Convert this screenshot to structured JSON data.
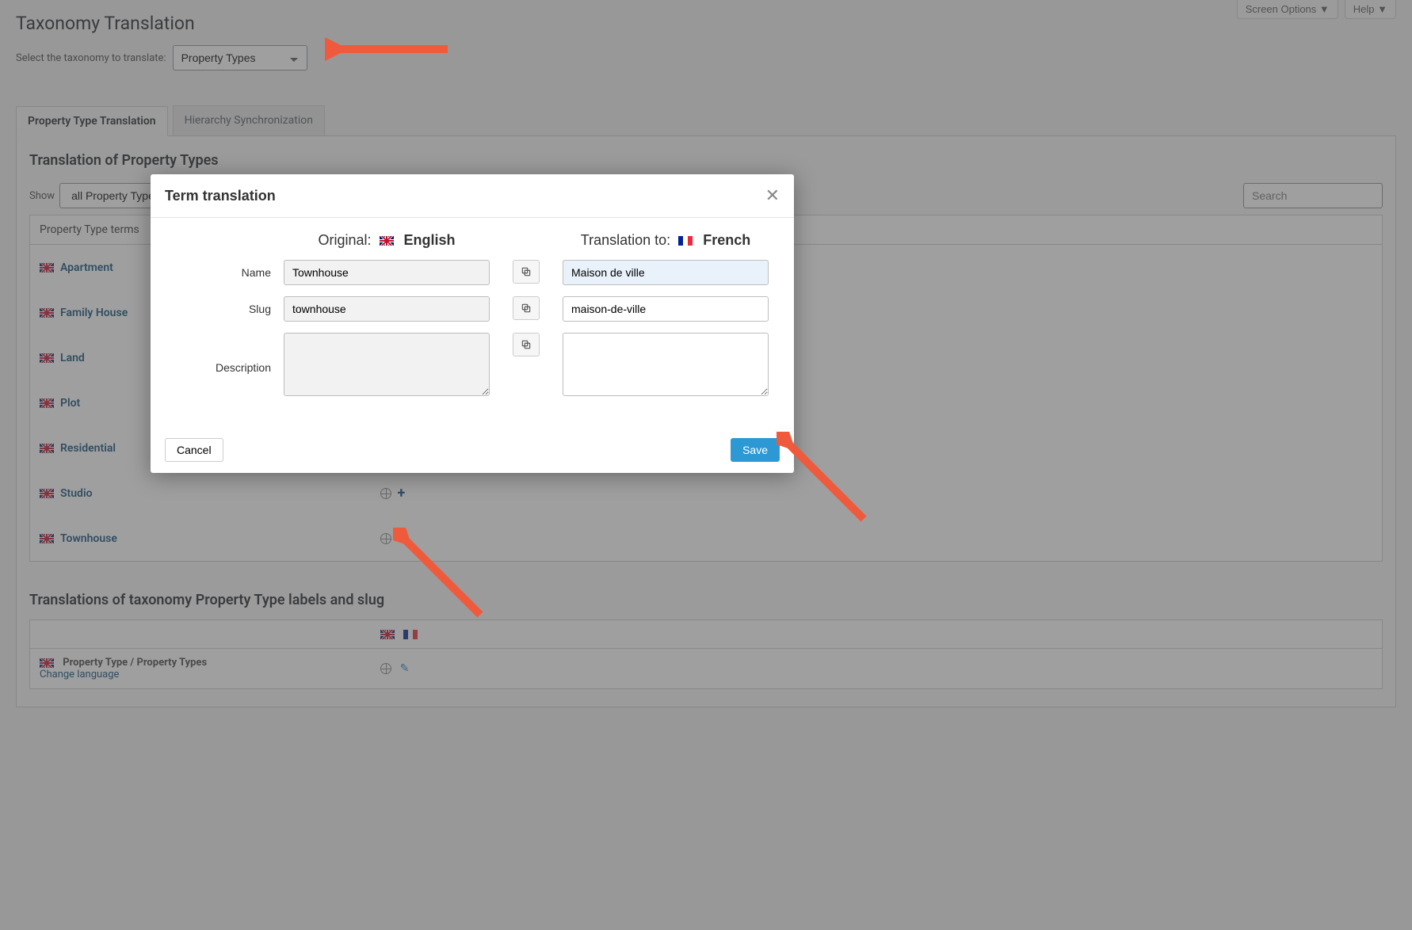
{
  "top_buttons": {
    "screen_options": "Screen Options ▼",
    "help": "Help ▼"
  },
  "page_title": "Taxonomy Translation",
  "select_label": "Select the taxonomy to translate:",
  "select_value": "Property Types",
  "tabs": {
    "translation": "Property Type Translation",
    "hierarchy": "Hierarchy Synchronization"
  },
  "section_heading": "Translation of Property Types",
  "show_label": "Show",
  "show_value": "all Property Types",
  "search_placeholder": "Search",
  "th_terms": "Property Type terms",
  "terms": [
    {
      "name": "Apartment"
    },
    {
      "name": "Family House"
    },
    {
      "name": "Land"
    },
    {
      "name": "Plot"
    },
    {
      "name": "Residential"
    },
    {
      "name": "Studio"
    },
    {
      "name": "Townhouse"
    }
  ],
  "section2_heading": "Translations of taxonomy Property Type labels and slug",
  "labels_row_text": "Property Type / Property Types",
  "change_language": "Change language",
  "modal": {
    "title": "Term translation",
    "original_label": "Original:",
    "original_lang": "English",
    "translation_label": "Translation to:",
    "translation_lang": "French",
    "name_label": "Name",
    "slug_label": "Slug",
    "desc_label": "Description",
    "name_orig": "Townhouse",
    "slug_orig": "townhouse",
    "desc_orig": "",
    "name_trans": "Maison de ville",
    "slug_trans": "maison-de-ville",
    "desc_trans": "",
    "cancel": "Cancel",
    "save": "Save"
  }
}
